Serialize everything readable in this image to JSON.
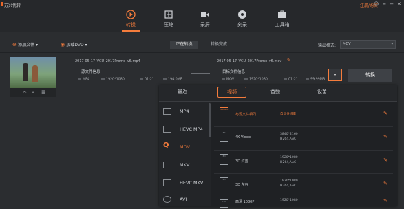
{
  "app": {
    "title": "万兴优转",
    "register": "注册/购买"
  },
  "nav": [
    {
      "label": "转换",
      "icon": "convert-icon",
      "active": true
    },
    {
      "label": "压缩",
      "icon": "compress-icon"
    },
    {
      "label": "录屏",
      "icon": "record-icon"
    },
    {
      "label": "刻录",
      "icon": "burn-icon"
    },
    {
      "label": "工具箱",
      "icon": "toolbox-icon"
    }
  ],
  "toolbar": {
    "add_file": "添加文件",
    "load_dvd": "加载DVD",
    "seg_converting": "正在转换",
    "seg_done": "转换完成",
    "output_format_label": "输出格式:",
    "output_format_value": "MOV"
  },
  "task": {
    "src_name": "2017-05-17_VCU_2017Promo_v6.mp4",
    "src_quality": "源文件信息",
    "src_meta": {
      "format": "MP4",
      "res": "1920*1080",
      "dur": "01:21",
      "size": "194.0MB"
    },
    "dst_name": "2017-05-17_VCU_2017Promo_v6.mov",
    "dst_quality": "目标文件信息",
    "dst_meta": {
      "format": "MOV",
      "res": "1920*1080",
      "dur": "01:21",
      "size": "99.99MB"
    },
    "convert_label": "转换"
  },
  "panel": {
    "tabs": [
      "最近",
      "视频",
      "音频",
      "设备"
    ],
    "active_tab": 1,
    "formats": [
      "MP4",
      "HEVC MP4",
      "MOV",
      "MKV",
      "HEVC MKV",
      "AVI"
    ],
    "active_format": 2,
    "presets": [
      {
        "name": "与源文件相同",
        "desc1": "自动分辨率",
        "desc2": "",
        "icon": "SOURCE"
      },
      {
        "name": "4K Video",
        "desc1": "3840*2160",
        "desc2": "H264,AAC",
        "icon": "4K"
      },
      {
        "name": "3D 红蓝",
        "desc1": "1920*1080",
        "desc2": "H264,AAC",
        "icon": "3D"
      },
      {
        "name": "3D 左右",
        "desc1": "1920*1080",
        "desc2": "H264,AAC",
        "icon": "3D"
      },
      {
        "name": "高清 1080P",
        "desc1": "1920*1080",
        "desc2": "",
        "icon": "HD"
      }
    ]
  }
}
